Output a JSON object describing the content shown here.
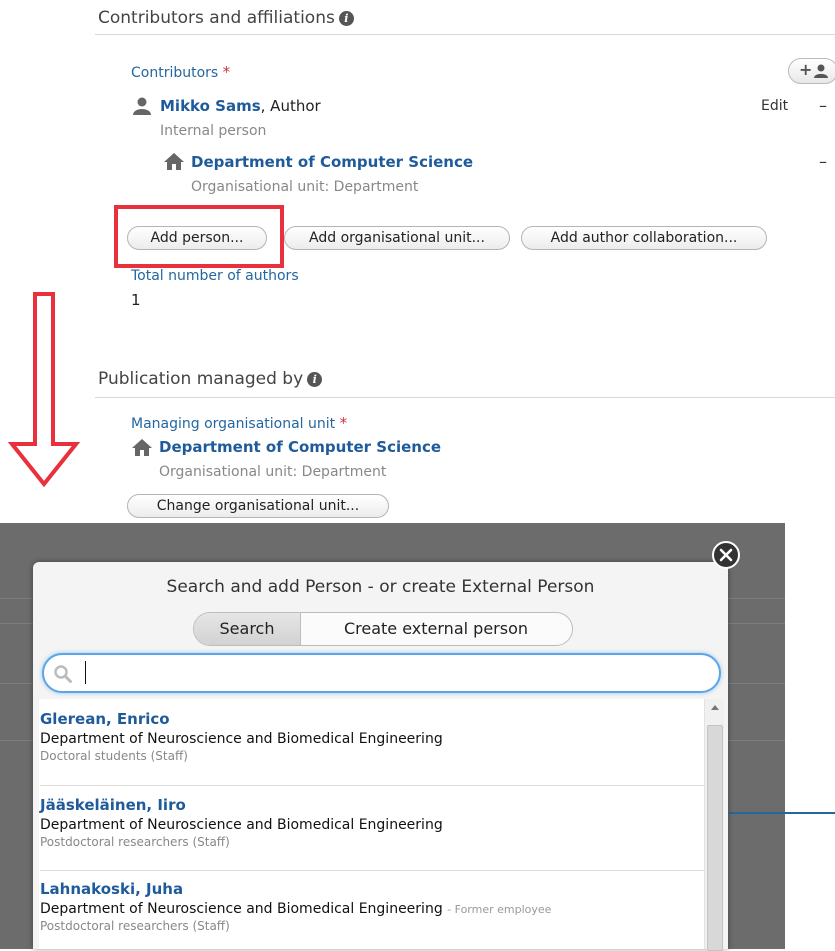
{
  "contributors_section": {
    "title": "Contributors and affiliations",
    "contributors_label": "Contributors",
    "required_mark": "*",
    "add_icon_label": "+",
    "person": {
      "name": "Mikko Sams",
      "role_suffix": ", Author",
      "type": "Internal person",
      "edit_label": "Edit",
      "remove_label": "–"
    },
    "org_unit": {
      "name": "Department of Computer Science",
      "type": "Organisational unit: Department",
      "remove_label": "–"
    },
    "buttons": {
      "add_person": "Add person...",
      "add_org_unit": "Add organisational unit...",
      "add_author_collab": "Add author collaboration..."
    },
    "total_authors_label": "Total number of authors",
    "total_authors_value": "1"
  },
  "managed_section": {
    "title": "Publication managed by",
    "managing_label": "Managing organisational unit",
    "required_mark": "*",
    "org_unit": {
      "name": "Department of Computer Science",
      "type": "Organisational unit: Department"
    },
    "change_button": "Change organisational unit..."
  },
  "dialog": {
    "title": "Search and add Person - or create External Person",
    "tabs": [
      "Search",
      "Create external person"
    ],
    "active_tab": "Search",
    "search_value": "",
    "results": [
      {
        "name": "Glerean, Enrico",
        "dept": "Department of Neuroscience and Biomedical Engineering",
        "note": "",
        "role": "Doctoral students (Staff)"
      },
      {
        "name": "Jääskeläinen, Iiro",
        "dept": "Department of Neuroscience and Biomedical Engineering",
        "note": "",
        "role": "Postdoctoral researchers (Staff)"
      },
      {
        "name": "Lahnakoski, Juha",
        "dept": "Department of Neuroscience and Biomedical Engineering",
        "note": "- Former employee",
        "role": "Postdoctoral researchers (Staff)"
      }
    ]
  },
  "colors": {
    "link_blue": "#1f5b9a",
    "highlight_red": "#e8313c",
    "focus_blue": "#5aa6e8"
  }
}
